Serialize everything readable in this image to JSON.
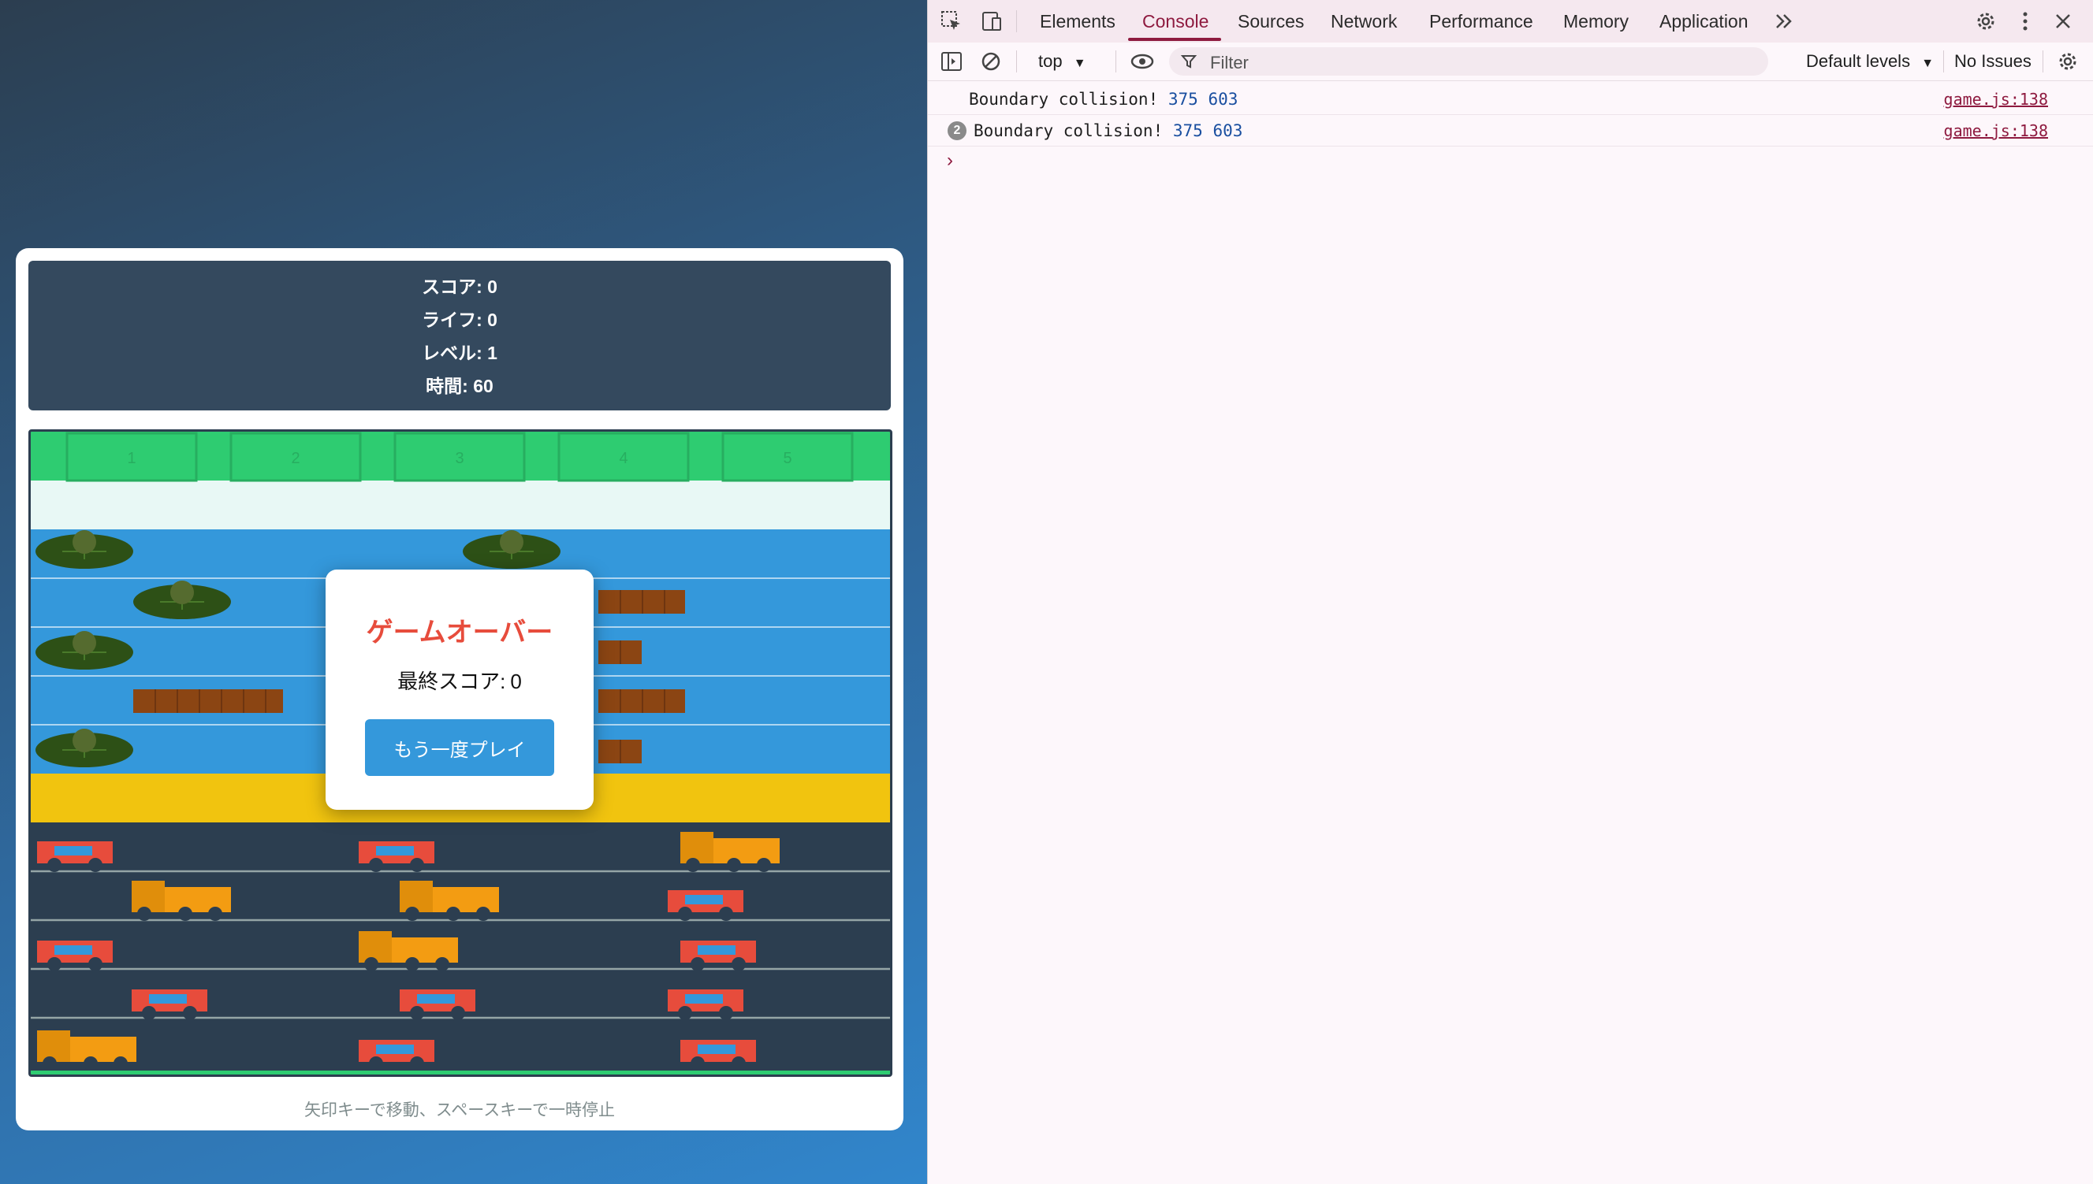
{
  "hud": {
    "score": "スコア: 0",
    "lives": "ライフ: 0",
    "level": "レベル: 1",
    "time": "時間: 60"
  },
  "goals": [
    "1",
    "2",
    "3",
    "4",
    "5"
  ],
  "game_over": {
    "title": "ゲームオーバー",
    "final_score_label": "最終スコア:",
    "final_score_value": "0",
    "retry_button": "もう一度プレイ"
  },
  "hint": "矢印キーで移動、スペースキーで一時停止",
  "colors": {
    "goal": "#2ecc71",
    "safe_top": "#e8f8f5",
    "river": "#3498db",
    "median": "#f1c40f",
    "road": "#2c3e50",
    "car": "#e74c3c",
    "truck": "#f39c12",
    "log": "#8b4513",
    "lilypad": "#2d5016",
    "accent_devtools": "#8e1a3f"
  },
  "devtools": {
    "tabs": [
      "Elements",
      "Console",
      "Sources",
      "Network",
      "Performance",
      "Memory",
      "Application"
    ],
    "active_tab": "Console",
    "context": "top",
    "filter_placeholder": "Filter",
    "levels": "Default levels",
    "issues": "No Issues",
    "logs": [
      {
        "count": "",
        "text": "Boundary collision!",
        "args": "375 603",
        "source": "game.js:138"
      },
      {
        "count": "2",
        "text": "Boundary collision!",
        "args": "375 603",
        "source": "game.js:138"
      }
    ],
    "prompt": "›"
  },
  "icons": {
    "inspect": "inspect-element-icon",
    "device": "device-toolbar-icon",
    "more_tabs": "chevron-double-right-icon",
    "settings": "gear-icon",
    "menu": "kebab-menu-icon",
    "close": "close-icon",
    "sidebar": "sidebar-toggle-icon",
    "clear": "clear-console-icon",
    "eye": "live-expression-eye-icon",
    "filter": "filter-icon"
  }
}
